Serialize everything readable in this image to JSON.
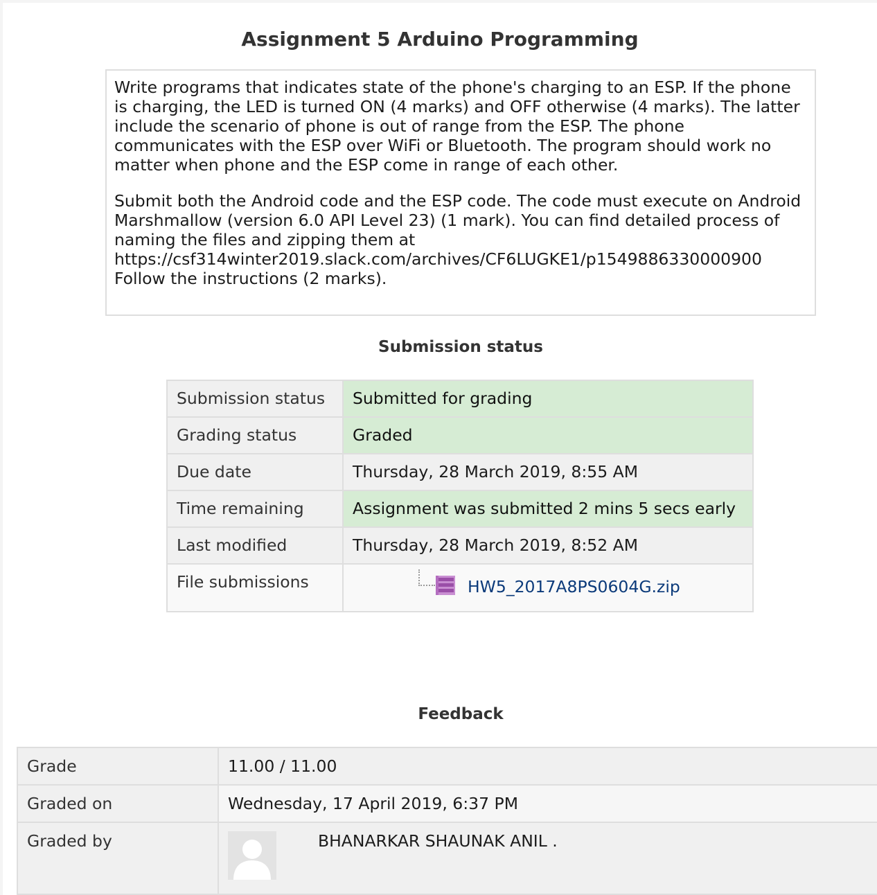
{
  "assignment": {
    "title": "Assignment 5 Arduino Programming",
    "intro_paragraphs": [
      "Write programs that indicates state of the phone's charging to an ESP. If the phone is charging, the LED is turned ON (4 marks) and OFF otherwise (4 marks). The latter include the scenario of phone is out of range from the ESP. The phone communicates with the ESP over WiFi or Bluetooth. The program should work no matter when phone and the ESP come in range of each other.",
      "Submit both the Android code and the ESP code. The code must execute on Android Marshmallow (version 6.0 API Level 23) (1 mark). You can find detailed process of naming the files and zipping them at https://csf314winter2019.slack.com/archives/CF6LUGKE1/p1549886330000900 Follow the instructions (2 marks)."
    ]
  },
  "submission": {
    "heading": "Submission status",
    "rows": [
      {
        "label": "Submission status",
        "value": "Submitted for grading"
      },
      {
        "label": "Grading status",
        "value": "Graded"
      },
      {
        "label": "Due date",
        "value": "Thursday, 28 March 2019, 8:55 AM"
      },
      {
        "label": "Time remaining",
        "value": "Assignment was submitted 2 mins 5 secs early"
      },
      {
        "label": "Last modified",
        "value": "Thursday, 28 March 2019, 8:52 AM"
      },
      {
        "label": "File submissions",
        "file_name": "HW5_2017A8PS0604G.zip",
        "icon": "zip-archive-icon"
      }
    ],
    "status_colors": {
      "success_bg": "#d6ecd4",
      "neutral_bg": "#f0f0f0"
    }
  },
  "feedback": {
    "heading": "Feedback",
    "rows": [
      {
        "label": "Grade",
        "value": "11.00 / 11.00"
      },
      {
        "label": "Graded on",
        "value": "Wednesday, 17 April 2019, 6:37 PM"
      },
      {
        "label": "Graded by",
        "value": "BHANARKAR SHAUNAK ANIL ."
      }
    ]
  },
  "colors": {
    "link": "#0b3a7a",
    "border": "#dedede"
  }
}
